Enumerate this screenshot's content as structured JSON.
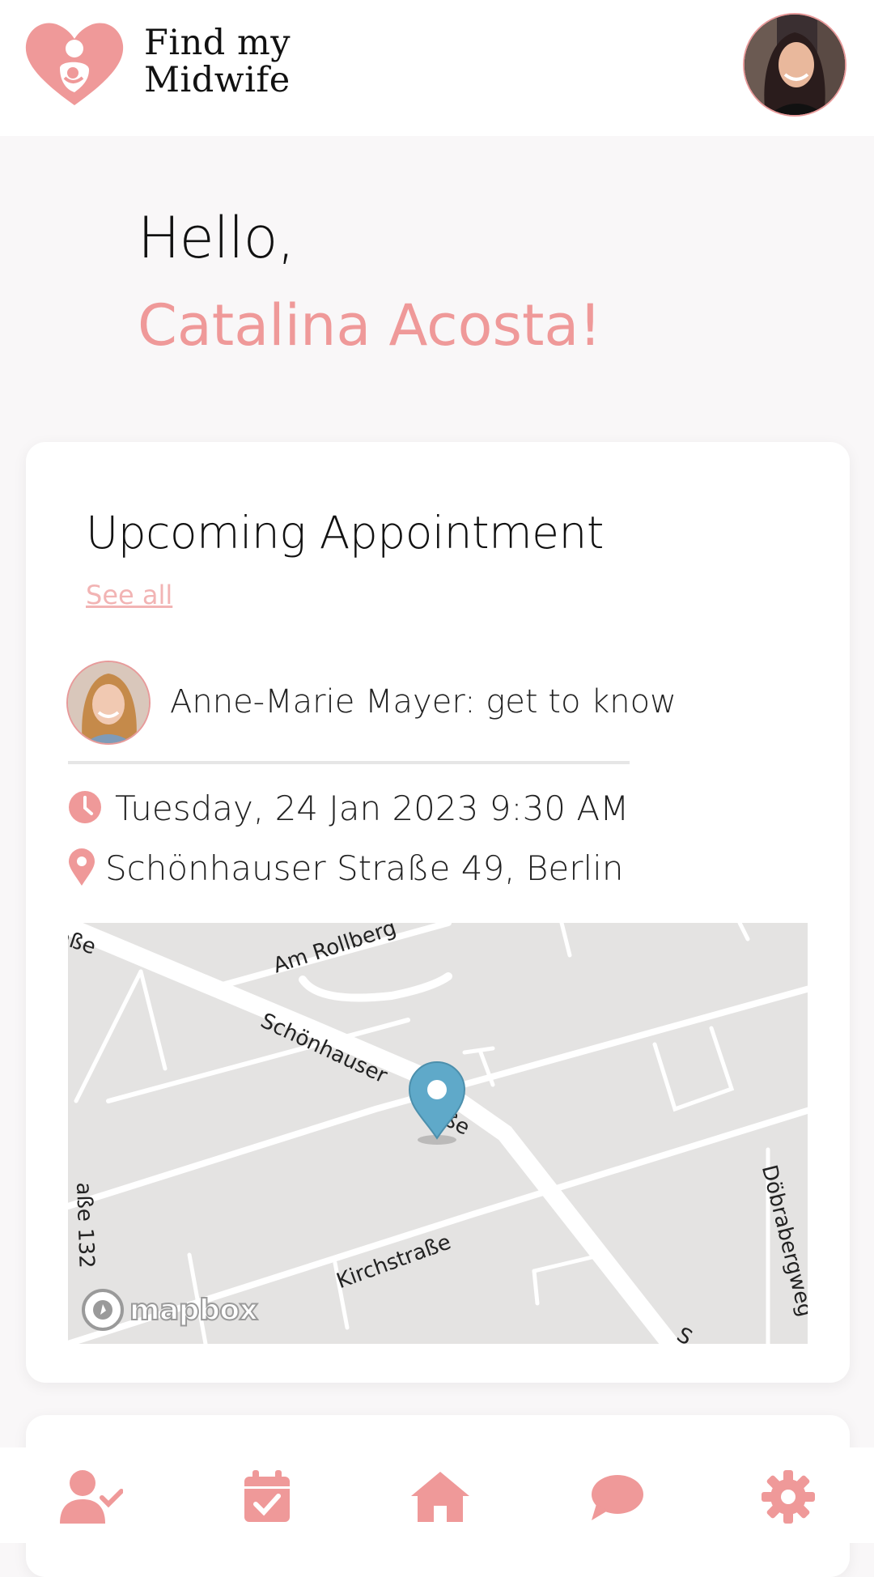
{
  "header": {
    "brand_line1": "Find my",
    "brand_line2": "Midwife",
    "logo_icon": "heart-mother-baby-icon"
  },
  "greeting": {
    "hello": "Hello,",
    "name": "Catalina Acosta!"
  },
  "appointment_card": {
    "title": "Upcoming Appointment",
    "see_all": "See all",
    "appointment": {
      "title": "Anne-Marie Mayer: get to know",
      "datetime": "Tuesday, 24 Jan 2023 9:30 AM",
      "address": "Schönhauser Straße 49, Berlin"
    },
    "map": {
      "streets": {
        "am_rollberg": "Am Rollberg",
        "schoenhauser": "Schönhauser",
        "strasse_suffix": "aße",
        "kirchstrasse": "Kirchstraße",
        "doebraberg": "Döbrabergweg",
        "partial_top_left": "aße",
        "partial_left": "aße 132",
        "partial_bottom": "S"
      },
      "attribution": "mapbox",
      "pin_color": "#5fa9c9"
    }
  },
  "bottom_nav": {
    "items": [
      "profile-check-icon",
      "calendar-check-icon",
      "home-icon",
      "chat-icon",
      "settings-icon"
    ]
  },
  "colors": {
    "accent": "#ef9999",
    "background": "#f9f7f8"
  }
}
